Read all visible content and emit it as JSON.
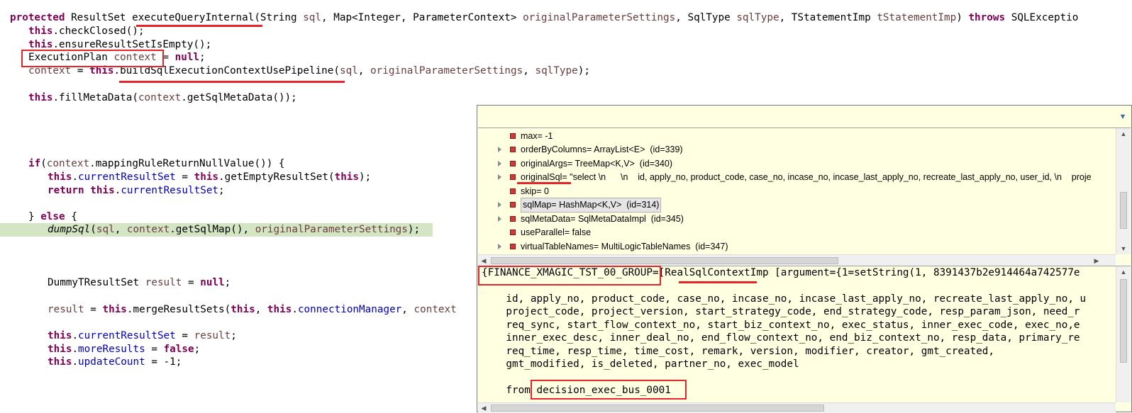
{
  "code": {
    "l1": {
      "kw_protected": "protected",
      "type": " ResultSet ",
      "method": "executeQueryInternal",
      "p1": "(String ",
      "sql": "sql",
      "p2": ", Map<Integer, ParameterContext> ",
      "ops": "originalParameterSettings",
      "p3": ", SqlType ",
      "st": "sqlType",
      "p4": ", TStatementImp ",
      "tsi": "tStatementImp",
      "p5": ") ",
      "kw_throws": "throws",
      "p6": " SQLExceptio"
    },
    "l2": {
      "kw": "this",
      "rest": ".checkClosed();"
    },
    "l3": {
      "kw": "this",
      "rest": ".ensureResultSetIsEmpty();"
    },
    "l4": {
      "type": "ExecutionPlan ",
      "var": "context",
      "mid": " = ",
      "kw": "null",
      "end": ";"
    },
    "l5": {
      "var": "context",
      "mid": " = ",
      "kw": "this",
      "call": ".buildSqlExecutionContextUsePipeline(",
      "a1": "sql",
      "c1": ", ",
      "a2": "originalParameterSettings",
      "c2": ", ",
      "a3": "sqlType",
      "end": ");"
    },
    "l7": {
      "kw": "this",
      "call": ".fillMetaData(",
      "var": "context",
      "end": ".getSqlMetaData());"
    },
    "l12": {
      "kw": "if",
      "p": "(",
      "var": "context",
      "end": ".mappingRuleReturnNullValue()) {"
    },
    "l13": {
      "kw": "this",
      "dot": ".",
      "fld": "currentResultSet",
      "mid": " = ",
      "kw2": "this",
      "call": ".getEmptyResultSet(",
      "kw3": "this",
      "end": ");"
    },
    "l14": {
      "kw": "return",
      "sp": " ",
      "kw2": "this",
      "dot": ".",
      "fld": "currentResultSet",
      "end": ";"
    },
    "l16": {
      "a": "} ",
      "kw": "else",
      "b": " {"
    },
    "l17": {
      "fn": "dumpSql",
      "p": "(",
      "a1": "sql",
      "c1": ", ",
      "a2": "context",
      "call": ".getSqlMap(), ",
      "a3": "originalParameterSettings",
      "end": ");"
    },
    "l21": {
      "type": "DummyTResultSet ",
      "var": "result",
      "mid": " = ",
      "kw": "null",
      "end": ";"
    },
    "l23": {
      "var": "result",
      "mid": " = ",
      "kw": "this",
      "call": ".mergeResultSets(",
      "kw2": "this",
      "c": ", ",
      "kw3": "this",
      "dot": ".",
      "fld": "connectionManager",
      "c2": ", ",
      "var2": "context"
    },
    "l25": {
      "kw": "this",
      "dot": ".",
      "fld": "currentResultSet",
      "mid": " = ",
      "var": "result",
      "end": ";"
    },
    "l26": {
      "kw": "this",
      "dot": ".",
      "fld": "moreResults",
      "mid": " = ",
      "kw2": "false",
      "end": ";"
    },
    "l27": {
      "kw": "this",
      "dot": ".",
      "fld": "updateCount",
      "end": " = -1;"
    }
  },
  "inspector": {
    "menu_glyph": "▼",
    "tree": [
      {
        "label": "max= -1",
        "expandable": false
      },
      {
        "label": "orderByColumns= ArrayList<E>  (id=339)",
        "expandable": true
      },
      {
        "label": "originalArgs= TreeMap<K,V>  (id=340)",
        "expandable": true
      },
      {
        "label": "originalSql= \"select \\n      \\n    id, apply_no, product_code, case_no, incase_no, incase_last_apply_no, recreate_last_apply_no, user_id, \\n    proje",
        "expandable": true
      },
      {
        "label": "skip= 0",
        "expandable": false
      },
      {
        "label": "sqlMap= HashMap<K,V>  (id=314)",
        "expandable": true,
        "selected": true
      },
      {
        "label": "sqlMetaData= SqlMetaDataImpl  (id=345)",
        "expandable": true
      },
      {
        "label": "useParallel= false",
        "expandable": false
      },
      {
        "label": "virtualTableNames= MultiLogicTableNames  (id=347)",
        "expandable": true
      }
    ],
    "detail": {
      "l1a": "{FINANCE_XMAGIC_TST_00_GROUP=[",
      "l1b": "RealSqlContextImp",
      "l1c": " [argument={1=setString(1, 8391437b2e914464a742577e",
      "l2": "    id, apply_no, product_code, case_no, incase_no, incase_last_apply_no, recreate_last_apply_no, u",
      "l3": "    project_code, project_version, start_strategy_code, end_strategy_code, resp_param_json, need_r",
      "l4": "    req_sync, start_flow_context_no, start_biz_context_no, exec_status, inner_exec_code, exec_no,e",
      "l5": "    inner_exec_desc, inner_deal_no, end_flow_context_no, end_biz_context_no, resp_data, primary_re",
      "l6": "    req_time, resp_time, time_cost, remark, version, modifier, creator, gmt_created,",
      "l7": "    gmt_modified, is_deleted, partner_no, exec_model",
      "l9a": "    from ",
      "l9b": "decision_exec_bus_0001"
    }
  },
  "colors": {
    "keyword": "#7f0055",
    "field": "#0000c0",
    "variable": "#6a3e3e",
    "highlight_line": "#d4e5c3",
    "annotation": "#e8242b",
    "popup_bg": "#ffffe1"
  }
}
